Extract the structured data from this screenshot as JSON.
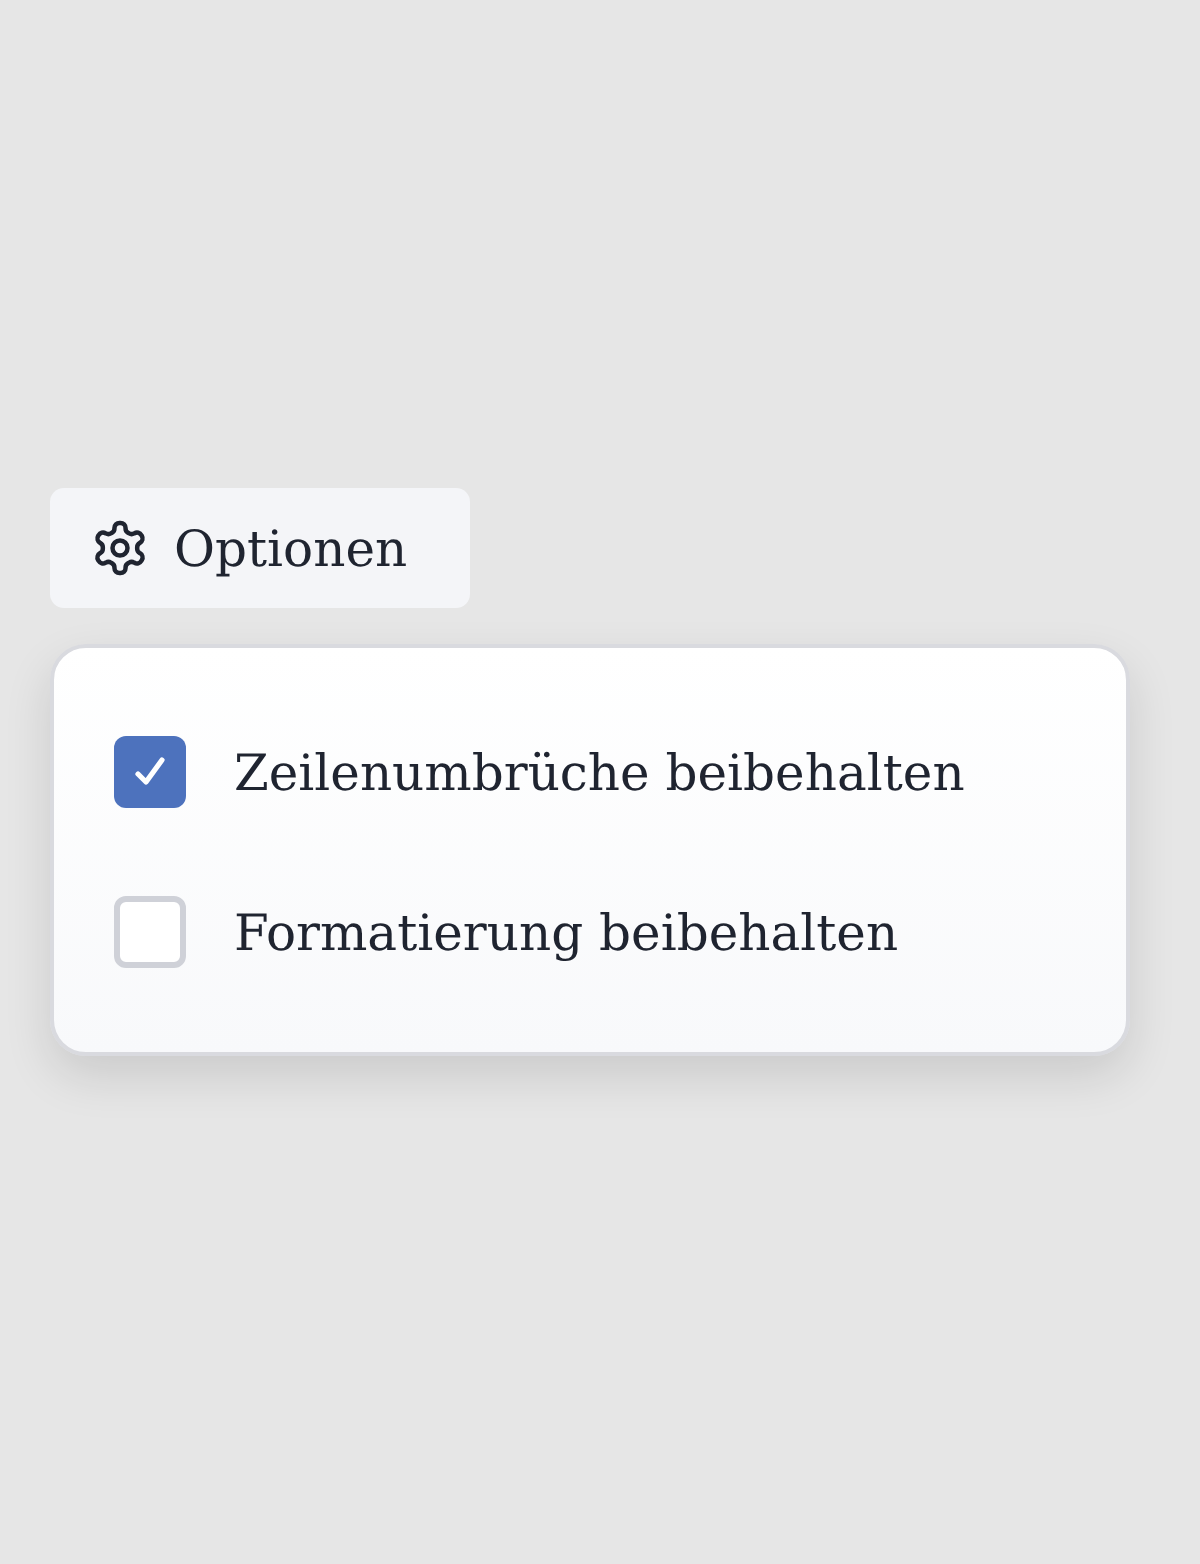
{
  "button": {
    "label": "Optionen"
  },
  "options": [
    {
      "label": "Zeilenumbrüche beibehalten",
      "checked": true
    },
    {
      "label": "Formatierung beibehalten",
      "checked": false
    }
  ]
}
